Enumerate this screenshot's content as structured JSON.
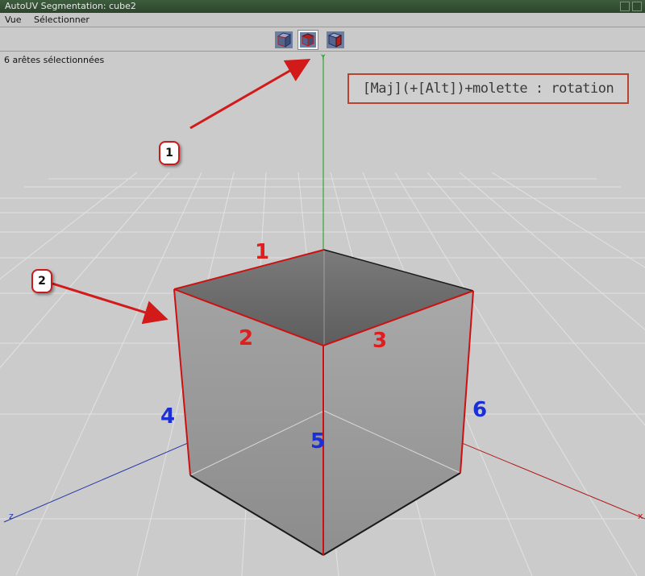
{
  "window": {
    "title": "AutoUV Segmentation: cube2"
  },
  "menu": {
    "items": [
      "Vue",
      "Sélectionner"
    ]
  },
  "toolbar": {
    "views": [
      {
        "icon": "cube-view-icon",
        "active": false
      },
      {
        "icon": "cube-view-icon",
        "active": true
      },
      {
        "icon": "cube-view-icon",
        "active": false
      }
    ]
  },
  "viewport": {
    "status": "6 arêtes sélectionnées",
    "hint": "[Maj](+[Alt])+molette : rotation",
    "axes": {
      "x": "x",
      "y": "Y",
      "z": "z"
    }
  },
  "callouts": [
    "1",
    "2"
  ],
  "edge_labels": {
    "red": [
      "1",
      "2",
      "3"
    ],
    "blue": [
      "4",
      "5",
      "6"
    ]
  },
  "colors": {
    "selected_edge": "#cc1111",
    "axis_x": "#b01818",
    "axis_y": "#1a9a1a",
    "axis_z": "#2233aa",
    "callout_border": "#c81b1b"
  }
}
